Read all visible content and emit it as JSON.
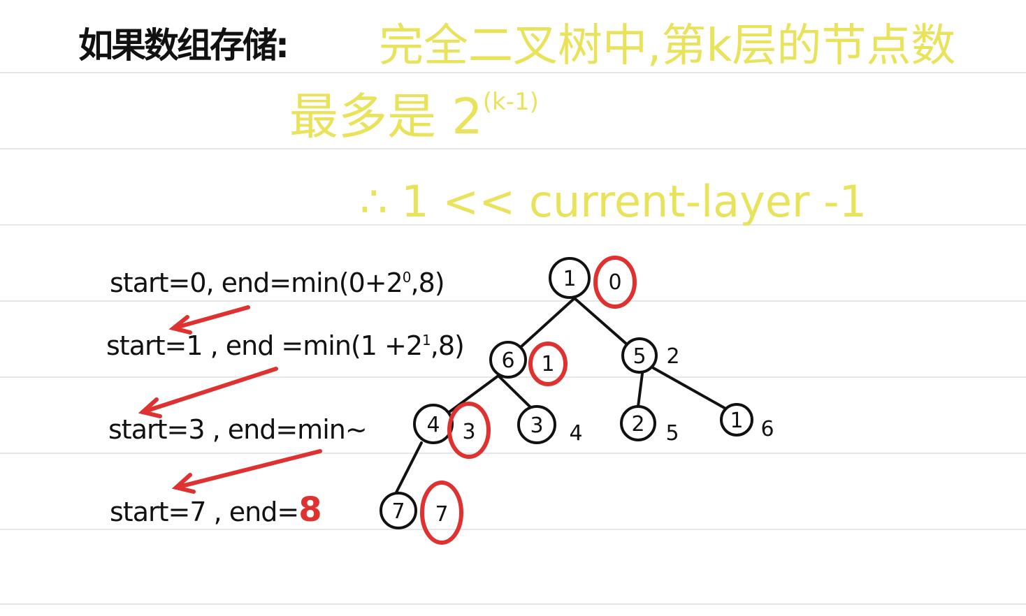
{
  "header": {
    "title": "如果数组存储:",
    "note_line1": "完全二叉树中,第k层的节点数",
    "note_line2_base": "最多是 2",
    "note_line2_exp": "(k-1)",
    "note_line3": "∴ 1 << current-layer -1"
  },
  "steps": {
    "step1_prefix": "start=0, end=min(0+2",
    "step1_exp": "0",
    "step1_suffix": ",8)",
    "step2_prefix": "start=1 , end =min(1 +2",
    "step2_exp": "1",
    "step2_suffix": ",8)",
    "step3": "start=3 , end=min~",
    "step4_prefix": "start=7 , end=",
    "step4_value": "8"
  },
  "tree": {
    "nodes": [
      {
        "value": "1",
        "index": "0",
        "highlighted": true
      },
      {
        "value": "6",
        "index": "1",
        "highlighted": true
      },
      {
        "value": "5",
        "index": "2",
        "highlighted": false
      },
      {
        "value": "4",
        "index": "3",
        "highlighted": true
      },
      {
        "value": "3",
        "index": "4",
        "highlighted": false
      },
      {
        "value": "2",
        "index": "5",
        "highlighted": false
      },
      {
        "value": "1",
        "index": "6",
        "highlighted": false
      },
      {
        "value": "7",
        "index": "7",
        "highlighted": true
      }
    ]
  },
  "colors": {
    "ink": "#111111",
    "highlight": "#e8e35a",
    "red": "#e03131",
    "rule": "#e6e6e6"
  }
}
